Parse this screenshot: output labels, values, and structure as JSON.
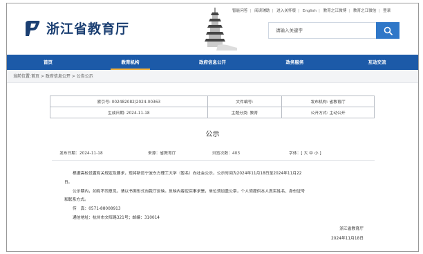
{
  "site": {
    "logo_text": "浙江省教育厅"
  },
  "top_links": [
    "智能问答",
    "阅读辅助",
    "进入关怀版",
    "English",
    "教育之江微博",
    "教育之江微信",
    "登录"
  ],
  "search": {
    "placeholder": "请输入关键字"
  },
  "nav": [
    "首页",
    "教育机构",
    "政府信息公开",
    "政务服务",
    "互动交流"
  ],
  "breadcrumb": "当前位置:首页 > 政府信息公开 > 公告公示",
  "meta": {
    "index_no": "索引号: 002482082/2024-00363",
    "doc_no": "文件编号:",
    "issuer": "发布机构: 省教育厅",
    "created": "生成日期: 2024-11-18",
    "topic": "主题分类: 教育",
    "open_mode": "公开方式: 主动公开"
  },
  "article": {
    "title": "公示",
    "publish_date": "发布日期：2024-11-18",
    "source": "来源：省教育厅",
    "views": "浏览次数：403",
    "font_size": "字体：[ 大 中 小 ]",
    "para1_line1": "根据高校设置有关规定及要求，现将新设宁波东方理工大学（暂名）向社会公示，公示时间为2024年11月18日至2024年11月22",
    "para1_line2": "日。",
    "para2_line1": "公示期内，如有不同意见，请以书面形式向我厅反映。反映内容应实事求是，单位须加盖公章，个人须提供本人真实姓名、身份证号",
    "para2_line2": "和联系方式。",
    "fax": "传　真：0571-88008913",
    "address": "通信地址：杭州市文晖路321号；邮编：310014",
    "sign_org": "浙江省教育厅",
    "sign_date": "2024年11月18日"
  }
}
